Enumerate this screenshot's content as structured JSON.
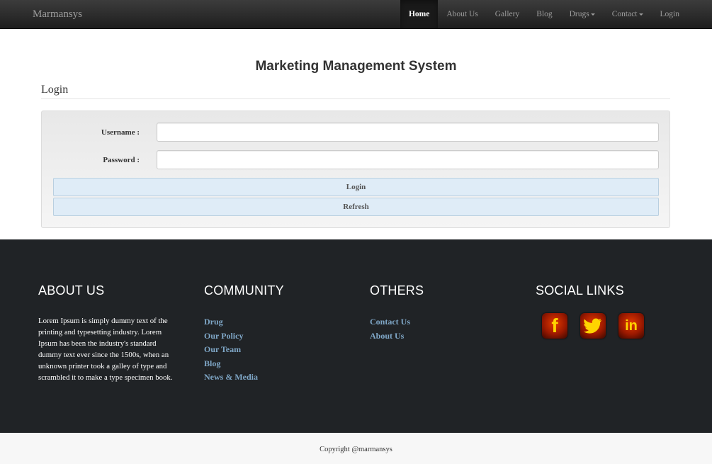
{
  "navbar": {
    "brand": "Marmansys",
    "items": [
      {
        "label": "Home",
        "active": true,
        "dropdown": false
      },
      {
        "label": "About Us",
        "active": false,
        "dropdown": false
      },
      {
        "label": "Gallery",
        "active": false,
        "dropdown": false
      },
      {
        "label": "Blog",
        "active": false,
        "dropdown": false
      },
      {
        "label": "Drugs",
        "active": false,
        "dropdown": true
      },
      {
        "label": "Contact",
        "active": false,
        "dropdown": true
      },
      {
        "label": "Login",
        "active": false,
        "dropdown": false
      }
    ]
  },
  "main": {
    "title": "Marketing Management System",
    "section_title": "Login",
    "form": {
      "username_label": "Username :",
      "username_value": "",
      "password_label": "Password :",
      "password_value": "",
      "login_button": "Login",
      "refresh_button": "Refresh"
    }
  },
  "footer": {
    "about": {
      "title": "ABOUT US",
      "text": "Lorem Ipsum is simply dummy text of the printing and typesetting industry. Lorem Ipsum has been the industry's standard dummy text ever since the 1500s, when an unknown printer took a galley of type and scrambled it to make a type specimen book."
    },
    "community": {
      "title": "COMMUNITY",
      "links": [
        "Drug",
        "Our Policy",
        "Our Team",
        "Blog",
        "News & Media"
      ]
    },
    "others": {
      "title": "OTHERS",
      "links": [
        "Contact Us",
        "About Us"
      ]
    },
    "social": {
      "title": "SOCIAL LINKS",
      "icons": [
        {
          "name": "facebook-icon",
          "glyph": "f"
        },
        {
          "name": "twitter-icon",
          "glyph": "🐦"
        },
        {
          "name": "linkedin-icon",
          "glyph": "in"
        }
      ]
    },
    "copyright": "Copyright @marmansys"
  },
  "colors": {
    "navbar": "#222222",
    "footer": "#202326",
    "link": "#7fa7c7",
    "button": "#dfecf7"
  }
}
